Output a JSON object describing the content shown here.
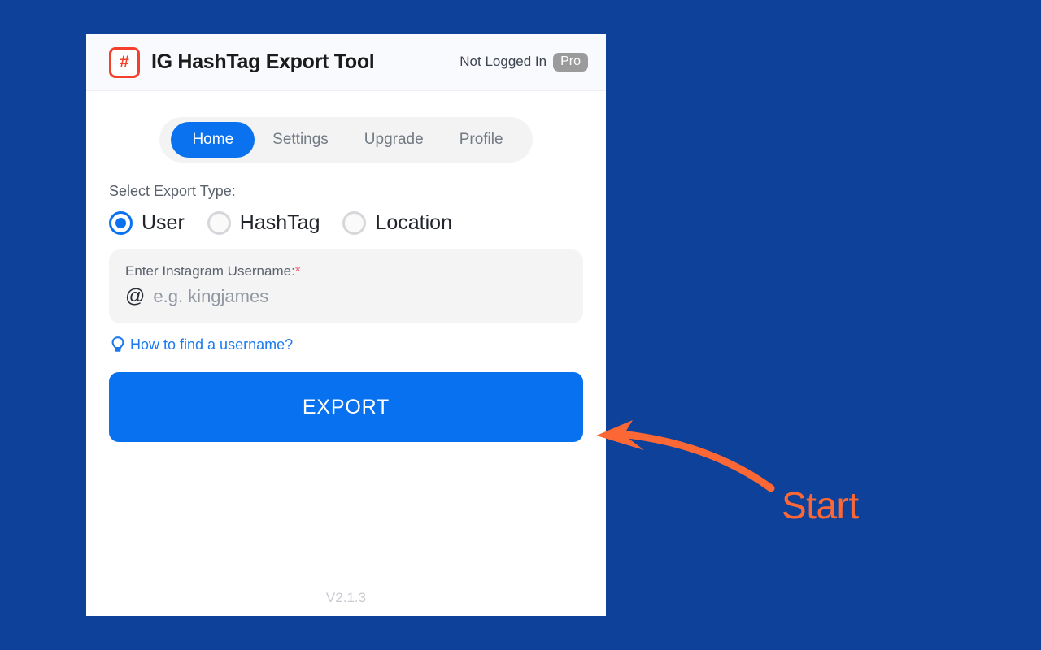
{
  "background_color": "#0e4199",
  "app": {
    "title": "IG HashTag Export Tool",
    "logo_icon": "hashtag-icon",
    "logo_glyph": "#",
    "login_status": "Not Logged In",
    "pro_badge": "Pro",
    "version": "V2.1.3"
  },
  "tabs": [
    {
      "label": "Home",
      "active": true
    },
    {
      "label": "Settings",
      "active": false
    },
    {
      "label": "Upgrade",
      "active": false
    },
    {
      "label": "Profile",
      "active": false
    }
  ],
  "form": {
    "export_type_label": "Select Export Type:",
    "options": [
      {
        "label": "User",
        "checked": true
      },
      {
        "label": "HashTag",
        "checked": false
      },
      {
        "label": "Location",
        "checked": false
      }
    ],
    "input_label": "Enter Instagram Username:",
    "required_marker": "*",
    "at_prefix": "@",
    "input_value": "",
    "input_placeholder": "e.g. kingjames",
    "help_link": "How to find a username?",
    "help_icon": "lightbulb-icon",
    "export_button": "EXPORT"
  },
  "annotation": {
    "label": "Start",
    "color": "#fb6836",
    "arrow_icon": "curved-arrow-left-icon"
  },
  "colors": {
    "accent_blue": "#0771ef",
    "brand_red": "#f5402c",
    "annotation_orange": "#fb6836",
    "page_blue": "#0e4199"
  }
}
